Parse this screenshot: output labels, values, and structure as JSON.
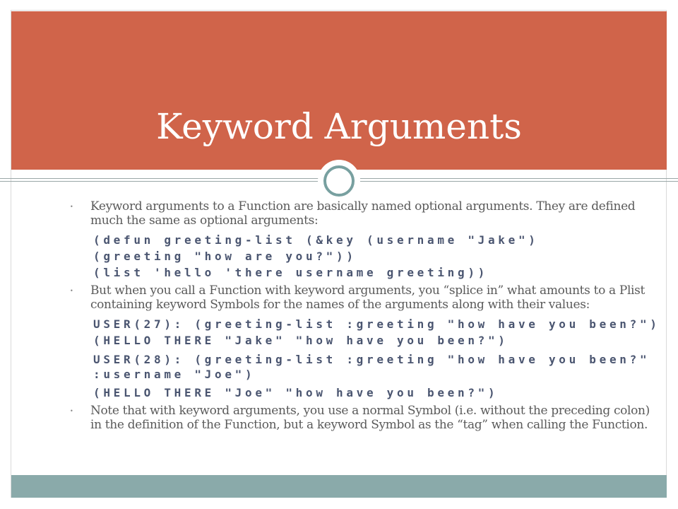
{
  "slide": {
    "title": "Keyword Arguments",
    "bullets": [
      {
        "text": "Keyword arguments to a Function are basically named optional arguments. They are defined much the same as optional arguments:",
        "code": [
          "(defun greeting-list (&key (username \"Jake\")",
          "(greeting \"how are you?\"))",
          "(list 'hello 'there username greeting))"
        ]
      },
      {
        "text": "But when you call a Function with keyword arguments, you “splice in” what amounts to a Plist containing keyword Symbols for the names of the arguments along with their values:",
        "code": [
          "USER(27): (greeting-list :greeting \"how have you been?\")",
          "(HELLO THERE \"Jake\" \"how have you been?\")",
          "USER(28): (greeting-list :greeting \"how have you been?\"",
          ":username \"Joe\")",
          "(HELLO THERE \"Joe\" \"how have you been?\")"
        ]
      },
      {
        "text": "Note that with keyword arguments, you use a normal Symbol (i.e. without the preceding colon) in the definition of the Function, but a keyword Symbol as the “tag” when calling the Function.",
        "code": []
      }
    ],
    "bullet_marker": "•"
  },
  "colors": {
    "title_band": "#d0644a",
    "footer_band": "#8aaaaa",
    "accent_ring": "#78a0a0",
    "body_text": "#5a5a5a",
    "code_text": "#4a5570"
  }
}
